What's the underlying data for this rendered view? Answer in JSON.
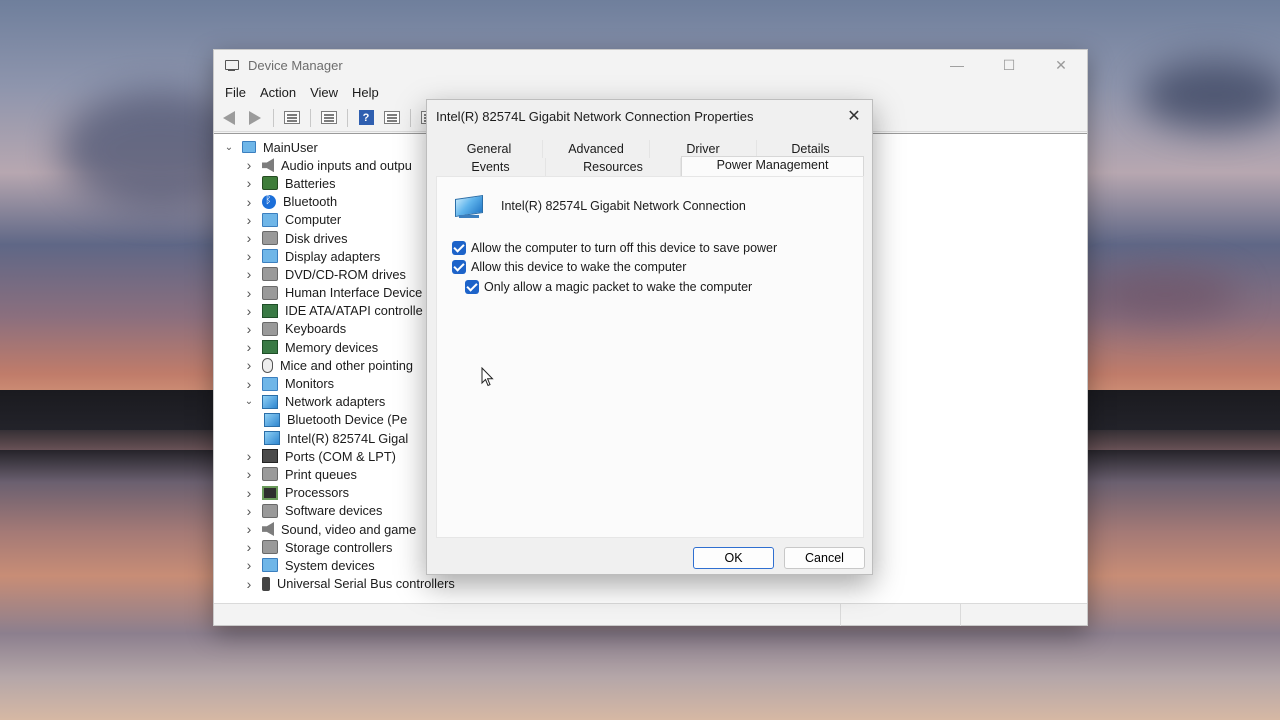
{
  "device_manager": {
    "title": "Device Manager",
    "menu": [
      "File",
      "Action",
      "View",
      "Help"
    ],
    "root": "MainUser",
    "categories": [
      {
        "label": "Audio inputs and outpu",
        "icon": "speaker-icon"
      },
      {
        "label": "Batteries",
        "icon": "battery-icon"
      },
      {
        "label": "Bluetooth",
        "icon": "bluetooth-icon"
      },
      {
        "label": "Computer",
        "icon": "monitor-icon"
      },
      {
        "label": "Disk drives",
        "icon": "disk-drive-icon"
      },
      {
        "label": "Display adapters",
        "icon": "display-adapter-icon"
      },
      {
        "label": "DVD/CD-ROM drives",
        "icon": "dvd-drive-icon"
      },
      {
        "label": "Human Interface Device",
        "icon": "hid-icon"
      },
      {
        "label": "IDE ATA/ATAPI controlle",
        "icon": "ide-controller-icon"
      },
      {
        "label": "Keyboards",
        "icon": "keyboard-icon"
      },
      {
        "label": "Memory devices",
        "icon": "memory-icon"
      },
      {
        "label": "Mice and other pointing",
        "icon": "mouse-icon"
      },
      {
        "label": "Monitors",
        "icon": "monitor-icon"
      },
      {
        "label": "Network adapters",
        "icon": "network-adapter-icon",
        "expanded": true
      },
      {
        "label": "Bluetooth Device (Pe",
        "icon": "network-adapter-icon",
        "child": true
      },
      {
        "label": "Intel(R) 82574L Gigal",
        "icon": "network-adapter-icon",
        "child": true
      },
      {
        "label": "Ports (COM & LPT)",
        "icon": "port-icon"
      },
      {
        "label": "Print queues",
        "icon": "printer-icon"
      },
      {
        "label": "Processors",
        "icon": "processor-icon"
      },
      {
        "label": "Software devices",
        "icon": "software-device-icon"
      },
      {
        "label": "Sound, video and game",
        "icon": "speaker-icon"
      },
      {
        "label": "Storage controllers",
        "icon": "storage-controller-icon"
      },
      {
        "label": "System devices",
        "icon": "system-device-icon"
      },
      {
        "label": "Universal Serial Bus controllers",
        "icon": "usb-icon"
      }
    ]
  },
  "dialog": {
    "title": "Intel(R) 82574L Gigabit Network Connection Properties",
    "tabs_row1": [
      "General",
      "Advanced",
      "Driver",
      "Details"
    ],
    "tabs_row2": [
      "Events",
      "Resources",
      "Power Management"
    ],
    "active_tab": "Power Management",
    "device_name": "Intel(R) 82574L Gigabit Network Connection",
    "options": [
      {
        "label": "Allow the computer to turn off this device to save power",
        "checked": true
      },
      {
        "label": "Allow this device to wake the computer",
        "checked": true
      },
      {
        "label": "Only allow a magic packet to wake the computer",
        "checked": true
      }
    ],
    "ok_label": "OK",
    "cancel_label": "Cancel"
  },
  "colors": {
    "accent": "#1d63c9",
    "window_bg": "#f3f3f3",
    "panel_bg": "#fbfbfb"
  }
}
